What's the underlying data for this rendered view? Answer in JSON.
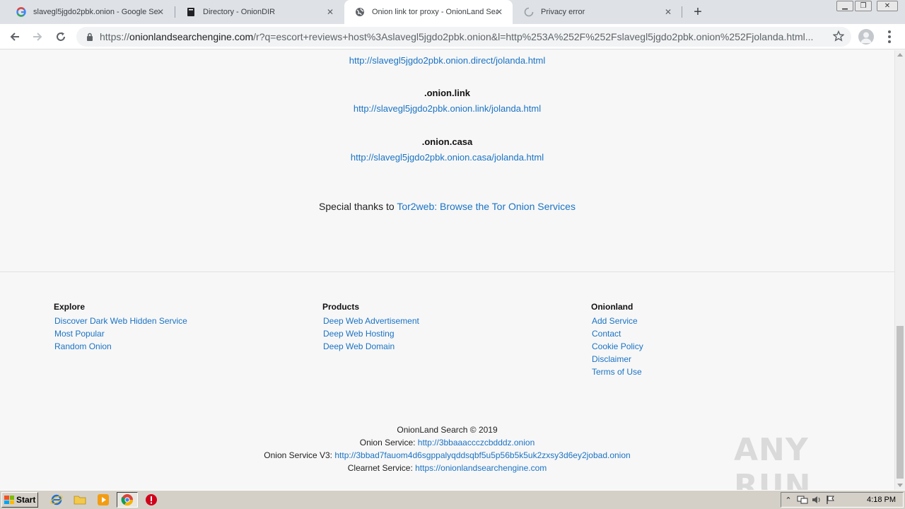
{
  "tabs": [
    {
      "title": "slavegl5jgdo2pbk.onion - Google Sea",
      "icon": "google-icon",
      "active": false
    },
    {
      "title": "Directory - OnionDIR",
      "icon": "book-icon",
      "active": false
    },
    {
      "title": "Onion link tor proxy - OnionLand Sea",
      "icon": "globe-icon",
      "active": true
    },
    {
      "title": "Privacy error",
      "icon": "loading-icon",
      "active": false
    }
  ],
  "address_bar": {
    "scheme": "https://",
    "host": "onionlandsearchengine.com",
    "path": "/r?q=escort+reviews+host%3Aslavegl5jgdo2pbk.onion&l=http%253A%252F%252Fslavegl5jgdo2pbk.onion%252Fjolanda.html..."
  },
  "proxies": {
    "direct_url": "http://slavegl5jgdo2pbk.onion.direct/jolanda.html",
    "link_title": ".onion.link",
    "link_url": "http://slavegl5jgdo2pbk.onion.link/jolanda.html",
    "casa_title": ".onion.casa",
    "casa_url": "http://slavegl5jgdo2pbk.onion.casa/jolanda.html"
  },
  "thanks": {
    "prefix": "Special thanks to ",
    "link": "Tor2web: Browse the Tor Onion Services"
  },
  "footer": {
    "explore": {
      "heading": "Explore",
      "links": [
        "Discover Dark Web Hidden Service",
        "Most Popular",
        "Random Onion"
      ]
    },
    "products": {
      "heading": "Products",
      "links": [
        "Deep Web Advertisement",
        "Deep Web Hosting",
        "Deep Web Domain"
      ]
    },
    "onionland": {
      "heading": "Onionland",
      "links": [
        "Add Service",
        "Contact",
        "Cookie Policy",
        "Disclaimer",
        "Terms of Use"
      ]
    },
    "copyright": "OnionLand Search © 2019",
    "onion_service_label": "Onion Service: ",
    "onion_service_url": "http://3bbaaaccczcbdddz.onion",
    "onion_v3_label": "Onion Service V3: ",
    "onion_v3_url": "http://3bbad7fauom4d6sgppalyqddsqbf5u5p56b5k5uk2zxsy3d6ey2jobad.onion",
    "clearnet_label": "Clearnet Service: ",
    "clearnet_url": "https://onionlandsearchengine.com"
  },
  "watermark": "ANY RUN",
  "taskbar": {
    "start_label": "Start",
    "clock": "4:18 PM"
  },
  "colors": {
    "link": "#1a73c4",
    "tab_strip": "#dee1e6",
    "page_bg": "#f7f7f7",
    "taskbar": "#d4d0c8"
  }
}
